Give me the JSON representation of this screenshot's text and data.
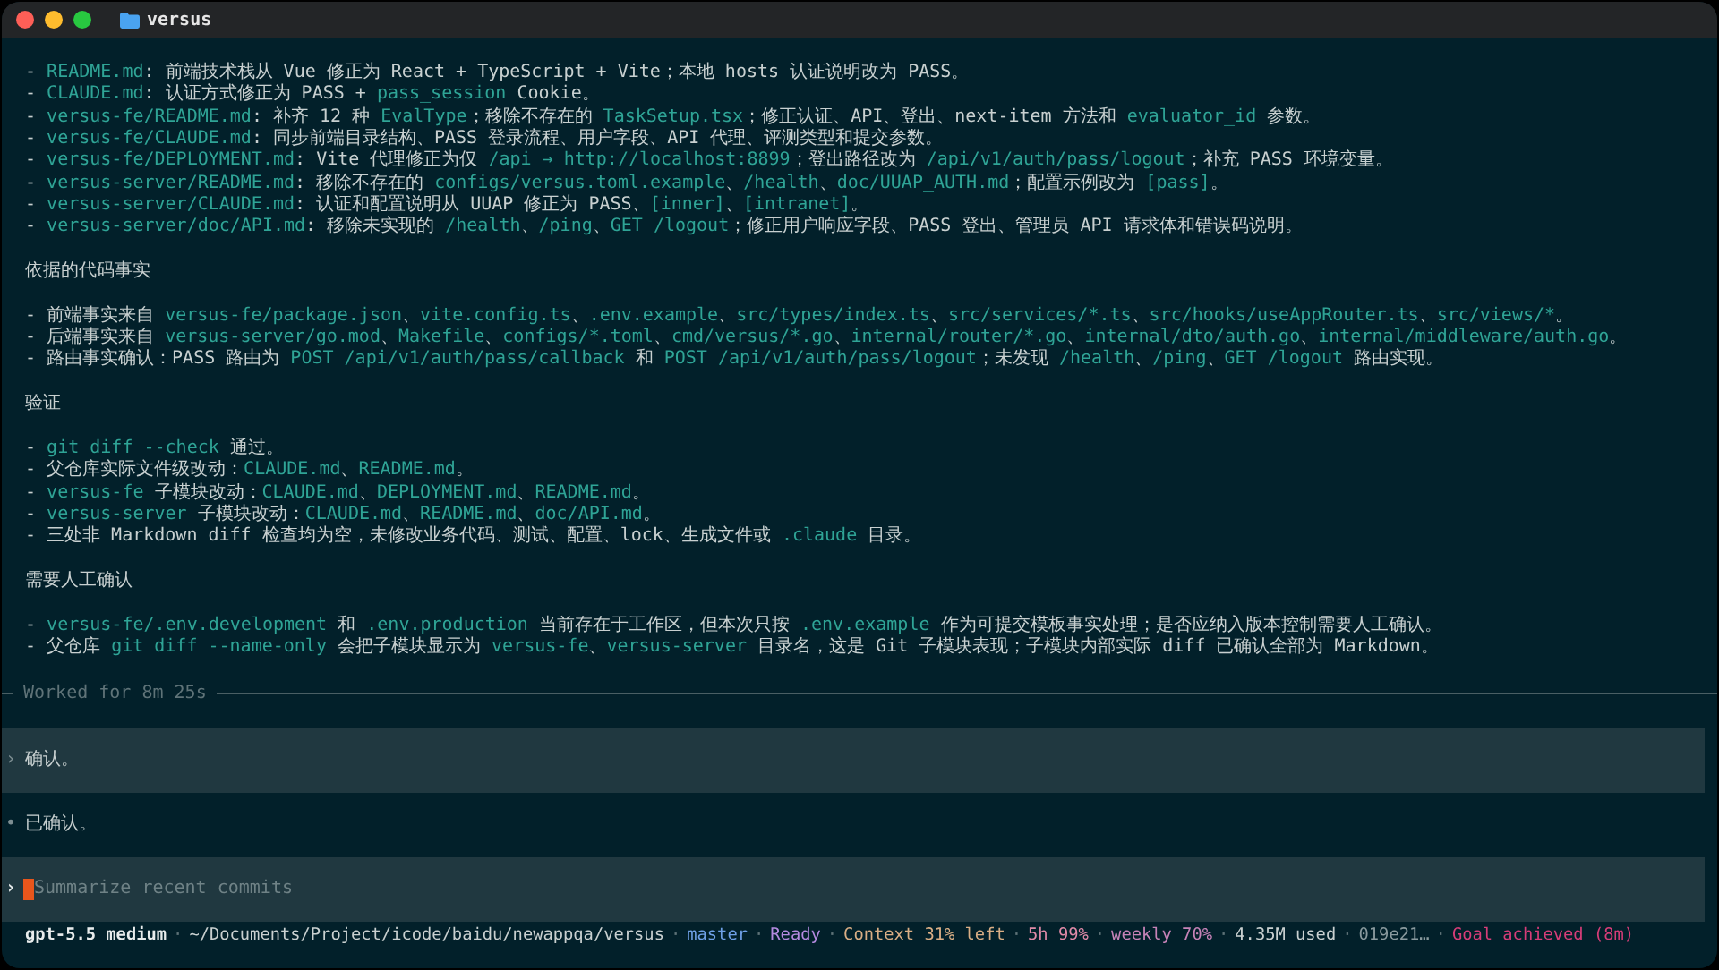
{
  "window": {
    "title": "versus"
  },
  "transcript": {
    "sections": [
      {
        "lines": [
          {
            "segments": [
              {
                "kind": "text",
                "text": "- "
              },
              {
                "kind": "code",
                "text": "README.md"
              },
              {
                "kind": "text",
                "text": ": 前端技术栈从 Vue 修正为 React + TypeScript + Vite；本地 hosts 认证说明改为 PASS。"
              }
            ]
          },
          {
            "segments": [
              {
                "kind": "text",
                "text": "- "
              },
              {
                "kind": "code",
                "text": "CLAUDE.md"
              },
              {
                "kind": "text",
                "text": ": 认证方式修正为 PASS + "
              },
              {
                "kind": "code",
                "text": "pass_session"
              },
              {
                "kind": "text",
                "text": " Cookie。"
              }
            ]
          },
          {
            "segments": [
              {
                "kind": "text",
                "text": "- "
              },
              {
                "kind": "code",
                "text": "versus-fe/README.md"
              },
              {
                "kind": "text",
                "text": ": 补齐 12 种 "
              },
              {
                "kind": "code",
                "text": "EvalType"
              },
              {
                "kind": "text",
                "text": "；移除不存在的 "
              },
              {
                "kind": "code",
                "text": "TaskSetup.tsx"
              },
              {
                "kind": "text",
                "text": "；修正认证、API、登出、next-item 方法和 "
              },
              {
                "kind": "code",
                "text": "evaluator_id"
              },
              {
                "kind": "text",
                "text": " 参数。"
              }
            ]
          },
          {
            "segments": [
              {
                "kind": "text",
                "text": "- "
              },
              {
                "kind": "code",
                "text": "versus-fe/CLAUDE.md"
              },
              {
                "kind": "text",
                "text": ": 同步前端目录结构、PASS 登录流程、用户字段、API 代理、评测类型和提交参数。"
              }
            ]
          },
          {
            "segments": [
              {
                "kind": "text",
                "text": "- "
              },
              {
                "kind": "code",
                "text": "versus-fe/DEPLOYMENT.md"
              },
              {
                "kind": "text",
                "text": ": Vite 代理修正为仅 "
              },
              {
                "kind": "code",
                "text": "/api → http://localhost:8899"
              },
              {
                "kind": "text",
                "text": "；登出路径改为 "
              },
              {
                "kind": "code",
                "text": "/api/v1/auth/pass/logout"
              },
              {
                "kind": "text",
                "text": "；补充 PASS 环境变量。"
              }
            ]
          },
          {
            "segments": [
              {
                "kind": "text",
                "text": "- "
              },
              {
                "kind": "code",
                "text": "versus-server/README.md"
              },
              {
                "kind": "text",
                "text": ": 移除不存在的 "
              },
              {
                "kind": "code",
                "text": "configs/versus.toml.example"
              },
              {
                "kind": "text",
                "text": "、"
              },
              {
                "kind": "code",
                "text": "/health"
              },
              {
                "kind": "text",
                "text": "、"
              },
              {
                "kind": "code",
                "text": "doc/UUAP_AUTH.md"
              },
              {
                "kind": "text",
                "text": "；配置示例改为 "
              },
              {
                "kind": "code",
                "text": "[pass]"
              },
              {
                "kind": "text",
                "text": "。"
              }
            ]
          },
          {
            "segments": [
              {
                "kind": "text",
                "text": "- "
              },
              {
                "kind": "code",
                "text": "versus-server/CLAUDE.md"
              },
              {
                "kind": "text",
                "text": ": 认证和配置说明从 UUAP 修正为 PASS、"
              },
              {
                "kind": "code",
                "text": "[inner]"
              },
              {
                "kind": "text",
                "text": "、"
              },
              {
                "kind": "code",
                "text": "[intranet]"
              },
              {
                "kind": "text",
                "text": "。"
              }
            ]
          },
          {
            "segments": [
              {
                "kind": "text",
                "text": "- "
              },
              {
                "kind": "code",
                "text": "versus-server/doc/API.md"
              },
              {
                "kind": "text",
                "text": ": 移除未实现的 "
              },
              {
                "kind": "code",
                "text": "/health"
              },
              {
                "kind": "text",
                "text": "、"
              },
              {
                "kind": "code",
                "text": "/ping"
              },
              {
                "kind": "text",
                "text": "、"
              },
              {
                "kind": "code",
                "text": "GET /logout"
              },
              {
                "kind": "text",
                "text": "；修正用户响应字段、PASS 登出、管理员 API 请求体和错误码说明。"
              }
            ]
          }
        ]
      },
      {
        "heading": "依据的代码事实",
        "lines": [
          {
            "segments": [
              {
                "kind": "text",
                "text": "- 前端事实来自 "
              },
              {
                "kind": "code",
                "text": "versus-fe/package.json"
              },
              {
                "kind": "text",
                "text": "、"
              },
              {
                "kind": "code",
                "text": "vite.config.ts"
              },
              {
                "kind": "text",
                "text": "、"
              },
              {
                "kind": "code",
                "text": ".env.example"
              },
              {
                "kind": "text",
                "text": "、"
              },
              {
                "kind": "code",
                "text": "src/types/index.ts"
              },
              {
                "kind": "text",
                "text": "、"
              },
              {
                "kind": "code",
                "text": "src/services/*.ts"
              },
              {
                "kind": "text",
                "text": "、"
              },
              {
                "kind": "code",
                "text": "src/hooks/useAppRouter.ts"
              },
              {
                "kind": "text",
                "text": "、"
              },
              {
                "kind": "code",
                "text": "src/views/*"
              },
              {
                "kind": "text",
                "text": "。"
              }
            ]
          },
          {
            "segments": [
              {
                "kind": "text",
                "text": "- 后端事实来自 "
              },
              {
                "kind": "code",
                "text": "versus-server/go.mod"
              },
              {
                "kind": "text",
                "text": "、"
              },
              {
                "kind": "code",
                "text": "Makefile"
              },
              {
                "kind": "text",
                "text": "、"
              },
              {
                "kind": "code",
                "text": "configs/*.toml"
              },
              {
                "kind": "text",
                "text": "、"
              },
              {
                "kind": "code",
                "text": "cmd/versus/*.go"
              },
              {
                "kind": "text",
                "text": "、"
              },
              {
                "kind": "code",
                "text": "internal/router/*.go"
              },
              {
                "kind": "text",
                "text": "、"
              },
              {
                "kind": "code",
                "text": "internal/dto/auth.go"
              },
              {
                "kind": "text",
                "text": "、"
              },
              {
                "kind": "code",
                "text": "internal/middleware/auth.go"
              },
              {
                "kind": "text",
                "text": "。"
              }
            ]
          },
          {
            "segments": [
              {
                "kind": "text",
                "text": "- 路由事实确认：PASS 路由为 "
              },
              {
                "kind": "code",
                "text": "POST /api/v1/auth/pass/callback"
              },
              {
                "kind": "text",
                "text": " 和 "
              },
              {
                "kind": "code",
                "text": "POST /api/v1/auth/pass/logout"
              },
              {
                "kind": "text",
                "text": "；未发现 "
              },
              {
                "kind": "code",
                "text": "/health"
              },
              {
                "kind": "text",
                "text": "、"
              },
              {
                "kind": "code",
                "text": "/ping"
              },
              {
                "kind": "text",
                "text": "、"
              },
              {
                "kind": "code",
                "text": "GET /logout"
              },
              {
                "kind": "text",
                "text": " 路由实现。"
              }
            ]
          }
        ]
      },
      {
        "heading": "验证",
        "lines": [
          {
            "segments": [
              {
                "kind": "text",
                "text": "- "
              },
              {
                "kind": "code",
                "text": "git diff --check"
              },
              {
                "kind": "text",
                "text": " 通过。"
              }
            ]
          },
          {
            "segments": [
              {
                "kind": "text",
                "text": "- 父仓库实际文件级改动："
              },
              {
                "kind": "code",
                "text": "CLAUDE.md"
              },
              {
                "kind": "text",
                "text": "、"
              },
              {
                "kind": "code",
                "text": "README.md"
              },
              {
                "kind": "text",
                "text": "。"
              }
            ]
          },
          {
            "segments": [
              {
                "kind": "text",
                "text": "- "
              },
              {
                "kind": "code",
                "text": "versus-fe"
              },
              {
                "kind": "text",
                "text": " 子模块改动："
              },
              {
                "kind": "code",
                "text": "CLAUDE.md"
              },
              {
                "kind": "text",
                "text": "、"
              },
              {
                "kind": "code",
                "text": "DEPLOYMENT.md"
              },
              {
                "kind": "text",
                "text": "、"
              },
              {
                "kind": "code",
                "text": "README.md"
              },
              {
                "kind": "text",
                "text": "。"
              }
            ]
          },
          {
            "segments": [
              {
                "kind": "text",
                "text": "- "
              },
              {
                "kind": "code",
                "text": "versus-server"
              },
              {
                "kind": "text",
                "text": " 子模块改动："
              },
              {
                "kind": "code",
                "text": "CLAUDE.md"
              },
              {
                "kind": "text",
                "text": "、"
              },
              {
                "kind": "code",
                "text": "README.md"
              },
              {
                "kind": "text",
                "text": "、"
              },
              {
                "kind": "code",
                "text": "doc/API.md"
              },
              {
                "kind": "text",
                "text": "。"
              }
            ]
          },
          {
            "segments": [
              {
                "kind": "text",
                "text": "- 三处非 Markdown diff 检查均为空，未修改业务代码、测试、配置、lock、生成文件或 "
              },
              {
                "kind": "code",
                "text": ".claude"
              },
              {
                "kind": "text",
                "text": " 目录。"
              }
            ]
          }
        ]
      },
      {
        "heading": "需要人工确认",
        "lines": [
          {
            "segments": [
              {
                "kind": "text",
                "text": "- "
              },
              {
                "kind": "code",
                "text": "versus-fe/.env.development"
              },
              {
                "kind": "text",
                "text": " 和 "
              },
              {
                "kind": "code",
                "text": ".env.production"
              },
              {
                "kind": "text",
                "text": " 当前存在于工作区，但本次只按 "
              },
              {
                "kind": "code",
                "text": ".env.example"
              },
              {
                "kind": "text",
                "text": " 作为可提交模板事实处理；是否应纳入版本控制需要人工确认。"
              }
            ]
          },
          {
            "segments": [
              {
                "kind": "text",
                "text": "- 父仓库 "
              },
              {
                "kind": "code",
                "text": "git diff --name-only"
              },
              {
                "kind": "text",
                "text": " 会把子模块显示为 "
              },
              {
                "kind": "code",
                "text": "versus-fe"
              },
              {
                "kind": "text",
                "text": "、"
              },
              {
                "kind": "code",
                "text": "versus-server"
              },
              {
                "kind": "text",
                "text": " 目录名，这是 Git 子模块表现；子模块内部实际 diff 已确认全部为 Markdown。"
              }
            ]
          }
        ]
      }
    ],
    "worked": "Worked for 8m 25s"
  },
  "messages": [
    {
      "kind": "user",
      "marker": "›",
      "text": "确认。"
    },
    {
      "kind": "assistant",
      "marker": "•",
      "text": "已确认。"
    }
  ],
  "input": {
    "marker": "›",
    "placeholder": "Summarize recent commits"
  },
  "status_bar": {
    "separator": "·",
    "items": [
      {
        "text": "gpt-5.5 medium",
        "color": "#e8ecec"
      },
      {
        "text": "~/Documents/Project/icode/baidu/newappqa/versus",
        "color": "#c9d0d0"
      },
      {
        "text": "master",
        "color": "#6fa0e6"
      },
      {
        "text": "Ready",
        "color": "#b48ae0"
      },
      {
        "text": "Context 31% left",
        "color": "#d9ae85"
      },
      {
        "text": "5h 99%",
        "color": "#e08aa8"
      },
      {
        "text": "weekly 70%",
        "color": "#c783b8"
      },
      {
        "text": "4.35M used",
        "color": "#c9d0d0"
      },
      {
        "text": "019e21…",
        "color": "#8a9a9e"
      },
      {
        "text": "Goal achieved (8m)",
        "color": "#d63d78"
      }
    ]
  }
}
